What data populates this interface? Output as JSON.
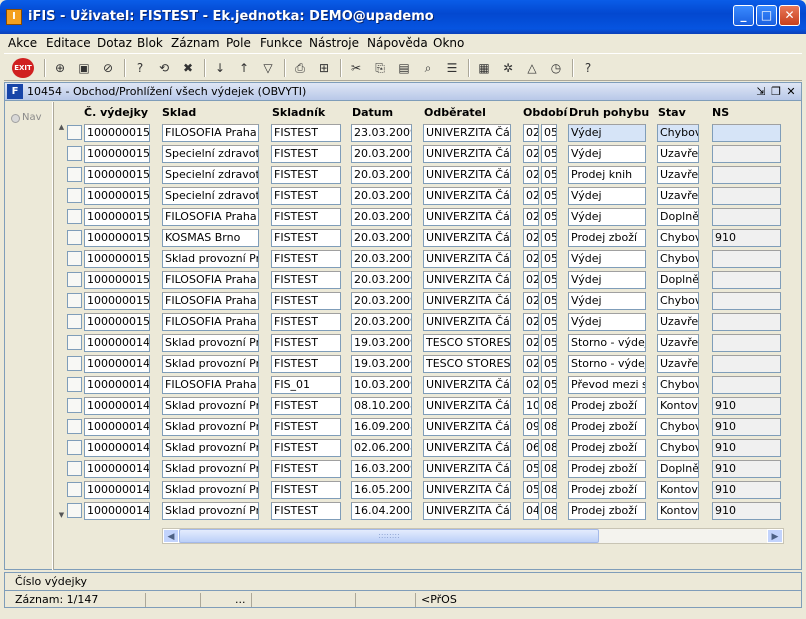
{
  "window": {
    "title": "iFIS - Uživatel: FISTEST - Ek.jednotka: DEMO@upademo",
    "app_icon_glyph": "I"
  },
  "menu": [
    "Akce",
    "Editace",
    "Dotaz",
    "Blok",
    "Záznam",
    "Pole",
    "Funkce",
    "Nástroje",
    "Nápověda",
    "Okno"
  ],
  "toolbar": {
    "exit_label": "EXIT",
    "icons": [
      "separator",
      "insert-record-icon",
      "save-icon",
      "delete-record-icon",
      "separator",
      "query-enter-icon",
      "query-execute-icon",
      "query-cancel-icon",
      "separator",
      "sort-asc-icon",
      "sort-desc-icon",
      "filter-icon",
      "separator",
      "print-icon",
      "print-setup-icon",
      "separator",
      "cut-icon",
      "copy-icon",
      "paste-icon",
      "find-icon",
      "list-icon",
      "separator",
      "calculator-icon",
      "tools-icon",
      "chart-icon",
      "clock-icon",
      "separator",
      "help-icon"
    ]
  },
  "form": {
    "title": "10454 - Obchod/Prohlížení všech výdejek (OBVYTI)",
    "nav_label": "Nav"
  },
  "columns": [
    "Č. výdejky",
    "Sklad",
    "Skladník",
    "Datum",
    "Odběratel",
    "Období",
    "Druh pohybu",
    "Stav",
    "NS"
  ],
  "rows": [
    {
      "cislo": "1000000159",
      "sklad": "FILOSOFIA Praha -",
      "skladnik": "FISTEST",
      "datum": "23.03.2009",
      "odberatel": "UNIVERZITA Část",
      "obd1": "02",
      "obd2": "05",
      "druh": "Výdej",
      "stav": "Chybov",
      "ns": ""
    },
    {
      "cislo": "1000000158",
      "sklad": "Specielní zdravot. r",
      "skladnik": "FISTEST",
      "datum": "20.03.2009",
      "odberatel": "UNIVERZITA Část",
      "obd1": "02",
      "obd2": "05",
      "druh": "Výdej",
      "stav": "Uzavřer",
      "ns": ""
    },
    {
      "cislo": "1000000157",
      "sklad": "Specielní zdravot. r",
      "skladnik": "FISTEST",
      "datum": "20.03.2009",
      "odberatel": "UNIVERZITA Část",
      "obd1": "02",
      "obd2": "05",
      "druh": "Prodej knih",
      "stav": "Uzavřer",
      "ns": ""
    },
    {
      "cislo": "1000000156",
      "sklad": "Specielní zdravot. r",
      "skladnik": "FISTEST",
      "datum": "20.03.2009",
      "odberatel": "UNIVERZITA Část",
      "obd1": "02",
      "obd2": "05",
      "druh": "Výdej",
      "stav": "Uzavřer",
      "ns": ""
    },
    {
      "cislo": "1000000155",
      "sklad": "FILOSOFIA Praha -",
      "skladnik": "FISTEST",
      "datum": "20.03.2009",
      "odberatel": "UNIVERZITA Část",
      "obd1": "02",
      "obd2": "05",
      "druh": "Výdej",
      "stav": "Doplněn",
      "ns": ""
    },
    {
      "cislo": "1000000154",
      "sklad": "KOSMAS Brno",
      "skladnik": "FISTEST",
      "datum": "20.03.2009",
      "odberatel": "UNIVERZITA Část",
      "obd1": "02",
      "obd2": "05",
      "druh": "Prodej zboží",
      "stav": "Chybov",
      "ns": "910"
    },
    {
      "cislo": "1000000153",
      "sklad": "Sklad provozní Prah",
      "skladnik": "FISTEST",
      "datum": "20.03.2009",
      "odberatel": "UNIVERZITA Část",
      "obd1": "02",
      "obd2": "05",
      "druh": "Výdej",
      "stav": "Chybov",
      "ns": ""
    },
    {
      "cislo": "1000000152",
      "sklad": "FILOSOFIA Praha -",
      "skladnik": "FISTEST",
      "datum": "20.03.2009",
      "odberatel": "UNIVERZITA Část",
      "obd1": "02",
      "obd2": "05",
      "druh": "Výdej",
      "stav": "Doplněn",
      "ns": ""
    },
    {
      "cislo": "1000000151",
      "sklad": "FILOSOFIA Praha -",
      "skladnik": "FISTEST",
      "datum": "20.03.2009",
      "odberatel": "UNIVERZITA Část",
      "obd1": "02",
      "obd2": "05",
      "druh": "Výdej",
      "stav": "Chybov",
      "ns": ""
    },
    {
      "cislo": "1000000150",
      "sklad": "FILOSOFIA Praha -",
      "skladnik": "FISTEST",
      "datum": "20.03.2009",
      "odberatel": "UNIVERZITA Část",
      "obd1": "02",
      "obd2": "05",
      "druh": "Výdej",
      "stav": "Uzavřer",
      "ns": ""
    },
    {
      "cislo": "1000000149",
      "sklad": "Sklad provozní Prah",
      "skladnik": "FISTEST",
      "datum": "19.03.2009",
      "odberatel": "TESCO STORES",
      "obd1": "02",
      "obd2": "05",
      "druh": "Storno - výdej",
      "stav": "Uzavřer",
      "ns": ""
    },
    {
      "cislo": "1000000148",
      "sklad": "Sklad provozní Prah",
      "skladnik": "FISTEST",
      "datum": "19.03.2009",
      "odberatel": "TESCO STORES",
      "obd1": "02",
      "obd2": "05",
      "druh": "Storno - výdej",
      "stav": "Uzavřer",
      "ns": ""
    },
    {
      "cislo": "1000000147",
      "sklad": "FILOSOFIA Praha -",
      "skladnik": "FIS_01",
      "datum": "10.03.2009",
      "odberatel": "UNIVERZITA Část",
      "obd1": "02",
      "obd2": "05",
      "druh": "Převod mezi skl",
      "stav": "Chybov",
      "ns": ""
    },
    {
      "cislo": "1000000146",
      "sklad": "Sklad provozní Prah",
      "skladnik": "FISTEST",
      "datum": "08.10.2008",
      "odberatel": "UNIVERZITA Část",
      "obd1": "10",
      "obd2": "08",
      "druh": "Prodej zboží",
      "stav": "Kontové",
      "ns": "910"
    },
    {
      "cislo": "1000000145",
      "sklad": "Sklad provozní Prah",
      "skladnik": "FISTEST",
      "datum": "16.09.2008",
      "odberatel": "UNIVERZITA Část",
      "obd1": "09",
      "obd2": "08",
      "druh": "Prodej zboží",
      "stav": "Chybov",
      "ns": "910"
    },
    {
      "cislo": "1000000144",
      "sklad": "Sklad provozní Prah",
      "skladnik": "FISTEST",
      "datum": "02.06.2008",
      "odberatel": "UNIVERZITA Část",
      "obd1": "06",
      "obd2": "08",
      "druh": "Prodej zboží",
      "stav": "Chybov",
      "ns": "910"
    },
    {
      "cislo": "1000000143",
      "sklad": "Sklad provozní Prah",
      "skladnik": "FISTEST",
      "datum": "16.03.2009",
      "odberatel": "UNIVERZITA Část",
      "obd1": "05",
      "obd2": "08",
      "druh": "Prodej zboží",
      "stav": "Doplněn",
      "ns": "910"
    },
    {
      "cislo": "1000000142",
      "sklad": "Sklad provozní Prah",
      "skladnik": "FISTEST",
      "datum": "16.05.2008",
      "odberatel": "UNIVERZITA Část",
      "obd1": "05",
      "obd2": "08",
      "druh": "Prodej zboží",
      "stav": "Kontové",
      "ns": "910"
    },
    {
      "cislo": "1000000141",
      "sklad": "Sklad provozní Prah",
      "skladnik": "FISTEST",
      "datum": "16.04.2008",
      "odberatel": "UNIVERZITA Část",
      "obd1": "04",
      "obd2": "08",
      "druh": "Prodej zboží",
      "stav": "Kontové",
      "ns": "910"
    }
  ],
  "status": {
    "hint": "Číslo výdejky",
    "record": "Záznam: 1/147",
    "ellipsis": "...",
    "mode": "<PřOS"
  }
}
